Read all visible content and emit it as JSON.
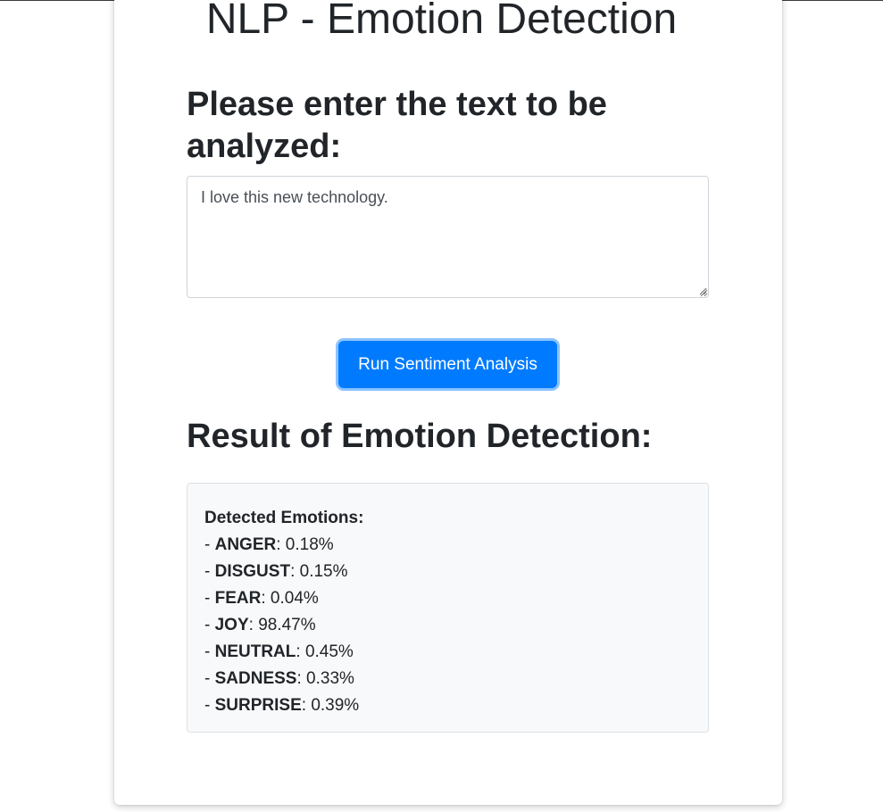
{
  "page": {
    "title": "NLP - Emotion Detection"
  },
  "input_section": {
    "heading": "Please enter the text to be analyzed:",
    "textarea_value": "I love this new technology."
  },
  "actions": {
    "run_label": "Run Sentiment Analysis"
  },
  "result_section": {
    "heading": "Result of Emotion Detection:",
    "detected_label": "Detected Emotions:",
    "emotions": [
      {
        "name": "ANGER",
        "value": "0.18%"
      },
      {
        "name": "DISGUST",
        "value": "0.15%"
      },
      {
        "name": "FEAR",
        "value": "0.04%"
      },
      {
        "name": "JOY",
        "value": "98.47%"
      },
      {
        "name": "NEUTRAL",
        "value": "0.45%"
      },
      {
        "name": "SADNESS",
        "value": "0.33%"
      },
      {
        "name": "SURPRISE",
        "value": "0.39%"
      }
    ]
  },
  "colors": {
    "primary": "#007bff",
    "text": "#212529",
    "result_bg": "#f8f9fa"
  }
}
